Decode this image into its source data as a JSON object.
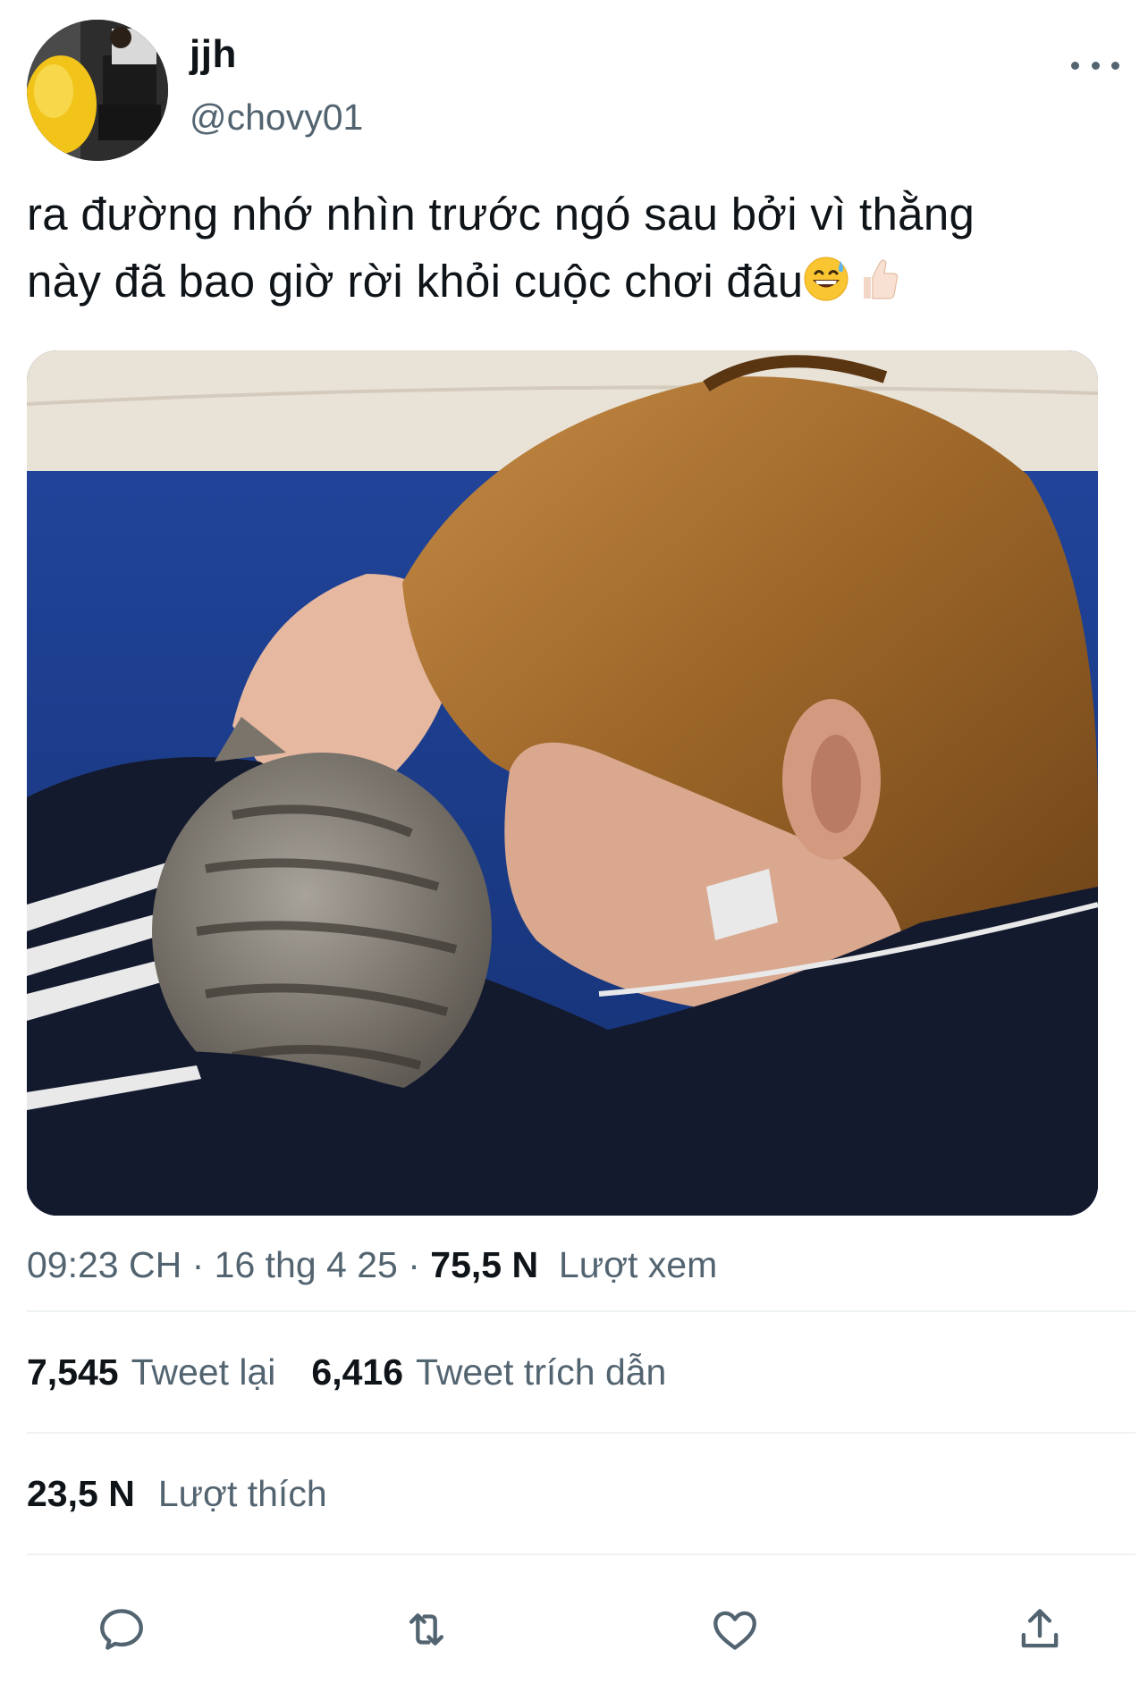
{
  "author": {
    "display_name": "jjh",
    "handle": "@chovy01"
  },
  "tweet": {
    "text_line1": "ra đường nhớ nhìn trước ngó sau bởi vì thằng",
    "text_line2": "này đã bao giờ rời khỏi cuộc chơi đâu",
    "emojis": [
      "grinning-sweat-emoji",
      "thumbs-up-light-skin-emoji"
    ]
  },
  "meta": {
    "time": "09:23 CH",
    "sep1": " · ",
    "date": "16 thg 4 25",
    "sep2": " · ",
    "views_count": "75,5 N",
    "views_label": "Lượt xem"
  },
  "stats": {
    "retweets_count": "7,545",
    "retweets_label": "Tweet lại",
    "quotes_count": "6,416",
    "quotes_label": "Tweet trích dẫn",
    "likes_count": "23,5 N",
    "likes_label": "Lượt thích"
  },
  "actions": [
    "reply-icon",
    "retweet-icon",
    "like-icon",
    "share-icon"
  ],
  "colors": {
    "text": "#0f1419",
    "secondary": "#536471",
    "divider": "#eff3f4"
  }
}
